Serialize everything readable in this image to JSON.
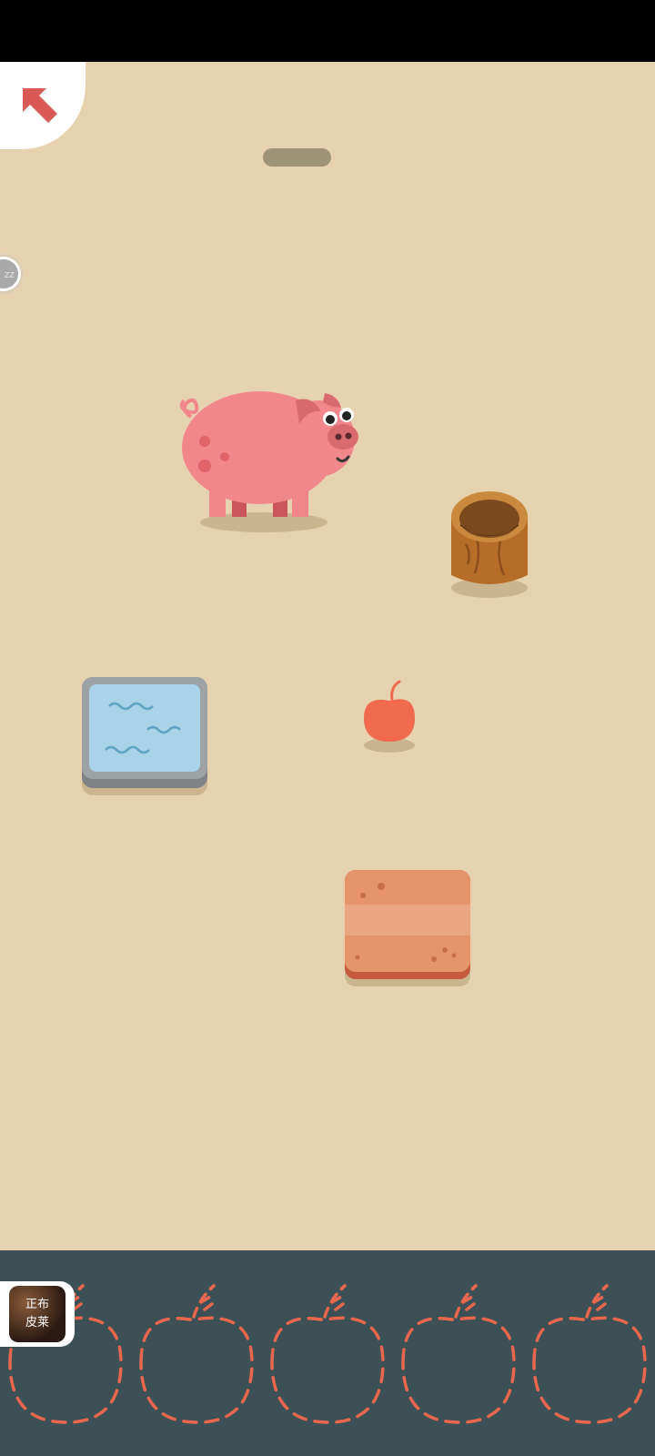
{
  "colors": {
    "background": "#e6d2ae",
    "tray": "#3c5055",
    "back_arrow": "#d95a55",
    "pig": "#f2878b",
    "apple": "#ef6a4f",
    "water": "#a9d3e6",
    "barrel": "#b56d27",
    "slot_outline": "#e9674e"
  },
  "hud": {
    "back_icon": "arrow-up-left-icon",
    "zz_label": "zz"
  },
  "scene": {
    "characters": [
      "pig"
    ],
    "objects": [
      "wooden-barrel",
      "water-trough",
      "apple",
      "clay-brick"
    ]
  },
  "tray": {
    "slots": [
      {
        "icon": "apple-outline-icon"
      },
      {
        "icon": "apple-outline-icon"
      },
      {
        "icon": "apple-outline-icon"
      },
      {
        "icon": "apple-outline-icon"
      },
      {
        "icon": "apple-outline-icon"
      }
    ],
    "ad_text": "正布\n皮莱"
  }
}
